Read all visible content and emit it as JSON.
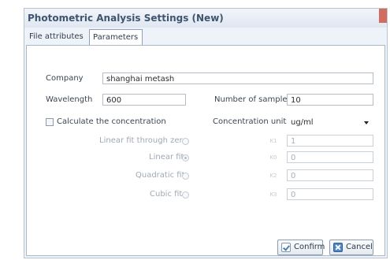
{
  "window": {
    "title": "Photometric Analysis Settings (New)"
  },
  "tabs": [
    {
      "label": "File attributes",
      "active": false
    },
    {
      "label": "Parameters",
      "active": true
    }
  ],
  "form": {
    "company_label": "Company",
    "company_value": "shanghai metash",
    "wavelength_label": "Wavelength",
    "wavelength_value": "600",
    "samples_label": "Number of samples",
    "samples_value": "10",
    "calc_label": "Calculate the concentration",
    "calc_checked": false,
    "units_label": "Concentration units",
    "units_value": "ug/ml"
  },
  "fits": [
    {
      "label": "Linear fit through zero",
      "coef_label": "K1",
      "value": "1",
      "selected": false
    },
    {
      "label": "Linear fit",
      "coef_label": "K0",
      "value": "0",
      "selected": true
    },
    {
      "label": "Quadratic fit",
      "coef_label": "K2",
      "value": "0",
      "selected": false
    },
    {
      "label": "Cubic fit",
      "coef_label": "K3",
      "value": "0",
      "selected": false
    }
  ],
  "buttons": {
    "confirm": "Confirm",
    "cancel": "Cancel"
  },
  "colors": {
    "title": "#3f546e",
    "accent": "#4f86c2",
    "window_bg": "#eef3f9"
  }
}
